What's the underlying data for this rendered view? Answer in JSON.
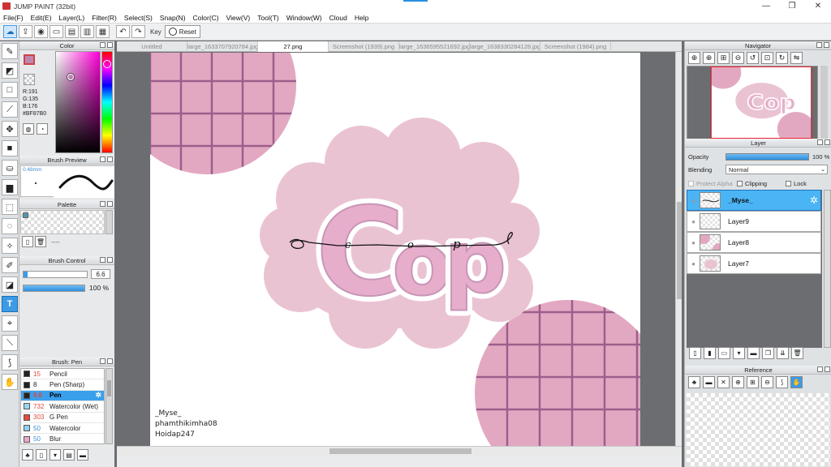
{
  "window": {
    "title": "JUMP PAINT (32bit)",
    "controls": [
      "—",
      "❐",
      "✕"
    ]
  },
  "menu": [
    "File(F)",
    "Edit(E)",
    "Layer(L)",
    "Filter(R)",
    "Select(S)",
    "Snap(N)",
    "Color(C)",
    "View(V)",
    "Tool(T)",
    "Window(W)",
    "Cloud",
    "Help"
  ],
  "command_bar": {
    "key_label": "Key",
    "reset_label": "Reset"
  },
  "tabs": [
    {
      "label": "Untitled",
      "active": false
    },
    {
      "label": "large_1633707920784.jpg",
      "active": false
    },
    {
      "label": "27.png",
      "active": true
    },
    {
      "label": "Screenshot (1939).png",
      "active": false
    },
    {
      "label": "large_1636595521692.jpg",
      "active": false
    },
    {
      "label": "large_1638330284128.jpg",
      "active": false
    },
    {
      "label": "Screenshot (1984).png",
      "active": false
    }
  ],
  "color_panel": {
    "title": "Color",
    "r": "R:191",
    "g": "G:135",
    "b": "B:176",
    "hex": "#BF87B0",
    "main_color": "#bf87b0"
  },
  "brush_preview": {
    "title": "Brush Preview",
    "size": "0.48mm"
  },
  "palette": {
    "title": "Palette",
    "empty_text": "----"
  },
  "brush_control": {
    "title": "Brush Control",
    "size_value": "6.6",
    "opacity_value": "100 %"
  },
  "brush_list": {
    "title": "Brush: Pen",
    "items": [
      {
        "size": "15",
        "name": "Pencil",
        "color": "#222222",
        "selected": false
      },
      {
        "size": "8",
        "name": "Pen (Sharp)",
        "color": "#222222",
        "selected": false
      },
      {
        "size": "6.6",
        "name": "Pen",
        "color": "#222222",
        "selected": true
      },
      {
        "size": "732",
        "name": "Watercolor (Wet)",
        "color": "#9ad6f0",
        "selected": false
      },
      {
        "size": "303",
        "name": "G Pen",
        "color": "#e84a3c",
        "selected": false
      },
      {
        "size": "50",
        "name": "Watercolor",
        "color": "#8fd0ee",
        "selected": false
      },
      {
        "size": "50",
        "name": "Blur",
        "color": "#e9a7d4",
        "selected": false
      }
    ]
  },
  "canvas": {
    "lettering": "Cop",
    "cursive_letters": [
      "c",
      "o",
      "p"
    ],
    "credits": [
      "_Myse_",
      "phamthikimha08",
      "Hoidap247"
    ],
    "pink_light": "#eac3d3",
    "pink_mid": "#e3a8c1",
    "grid_line": "#9c5e8c"
  },
  "navigator": {
    "title": "Navigator"
  },
  "layer_panel": {
    "title": "Layer",
    "opacity_label": "Opacity",
    "opacity_value": "100 %",
    "blending_label": "Blending",
    "blending_value": "Normal",
    "protect_alpha": "Protect Alpha",
    "clipping": "Clipping",
    "lock": "Lock",
    "layers": [
      {
        "name": "_Myse_",
        "selected": true
      },
      {
        "name": "Layer9",
        "selected": false
      },
      {
        "name": "Layer8",
        "selected": false
      },
      {
        "name": "Layer7",
        "selected": false
      }
    ]
  },
  "reference": {
    "title": "Reference"
  }
}
